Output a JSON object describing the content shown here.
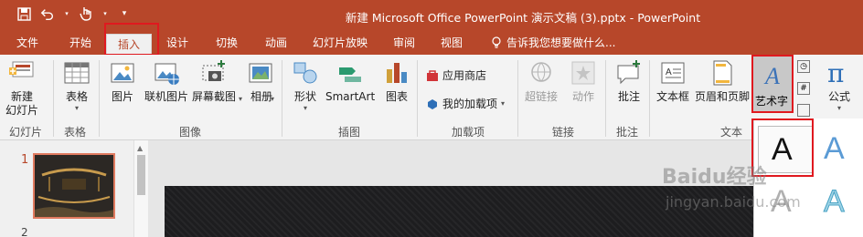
{
  "window": {
    "title": "新建 Microsoft Office PowerPoint 演示文稿 (3).pptx - PowerPoint"
  },
  "qat": {
    "save_icon": "save-icon",
    "undo_icon": "undo-icon",
    "touch_icon": "touch-mode-icon",
    "customize_icon": "customize-qat-icon"
  },
  "tabs": [
    {
      "label": "文件"
    },
    {
      "label": "开始"
    },
    {
      "label": "插入"
    },
    {
      "label": "设计"
    },
    {
      "label": "切换"
    },
    {
      "label": "动画"
    },
    {
      "label": "幻灯片放映"
    },
    {
      "label": "审阅"
    },
    {
      "label": "视图"
    }
  ],
  "tellme": {
    "placeholder": "告诉我您想要做什么..."
  },
  "ribbon": {
    "new_slide": "新建\n幻灯片",
    "table": "表格",
    "picture": "图片",
    "online_picture": "联机图片",
    "screenshot": "屏幕截图",
    "album": "相册",
    "shapes": "形状",
    "smartart": "SmartArt",
    "chart": "图表",
    "store": "应用商店",
    "my_addins": "我的加载项",
    "hyperlink": "超链接",
    "action": "动作",
    "comment": "批注",
    "textbox": "文本框",
    "header_footer": "页眉和页脚",
    "wordart": "艺术字",
    "equation": "公式"
  },
  "groups": {
    "slides": "幻灯片",
    "tables": "表格",
    "images": "图像",
    "illustrations": "插图",
    "addins": "加载项",
    "links": "链接",
    "comments": "批注",
    "text": "文本"
  },
  "slide_pane": {
    "slide1_num": "1",
    "slide2_num": "2"
  },
  "gallery": {
    "letter": "A"
  },
  "watermark": {
    "brand": "Baidu经验",
    "url": "jingyan.baidu.com"
  },
  "colors": {
    "accent": "#b7472a",
    "highlight": "#e0191f"
  }
}
